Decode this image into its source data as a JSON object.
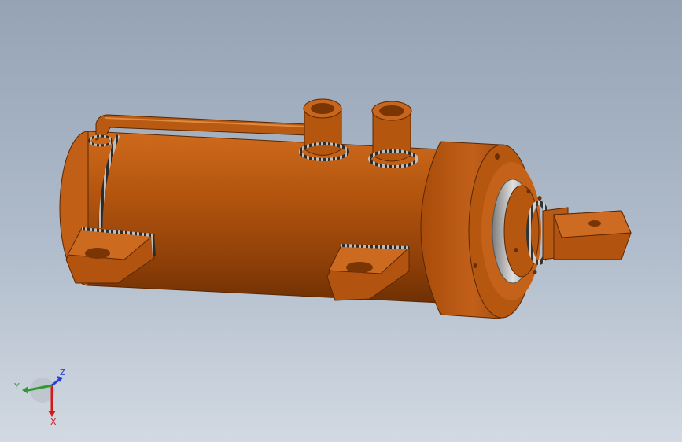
{
  "viewport": {
    "background_top": "#95a3b5",
    "background_bottom": "#d2d9e2"
  },
  "model": {
    "body_color": "#b5560f",
    "body_shadow": "#7a3505",
    "body_highlight": "#d7742a",
    "weld_color": "#2b2b2b",
    "bearing_color": "#9c9c9c"
  },
  "triad": {
    "x_label": "X",
    "y_label": "Y",
    "z_label": "Z",
    "x_color": "#d11a1a",
    "y_color": "#2f9a2f",
    "z_color": "#2a3fd6"
  }
}
